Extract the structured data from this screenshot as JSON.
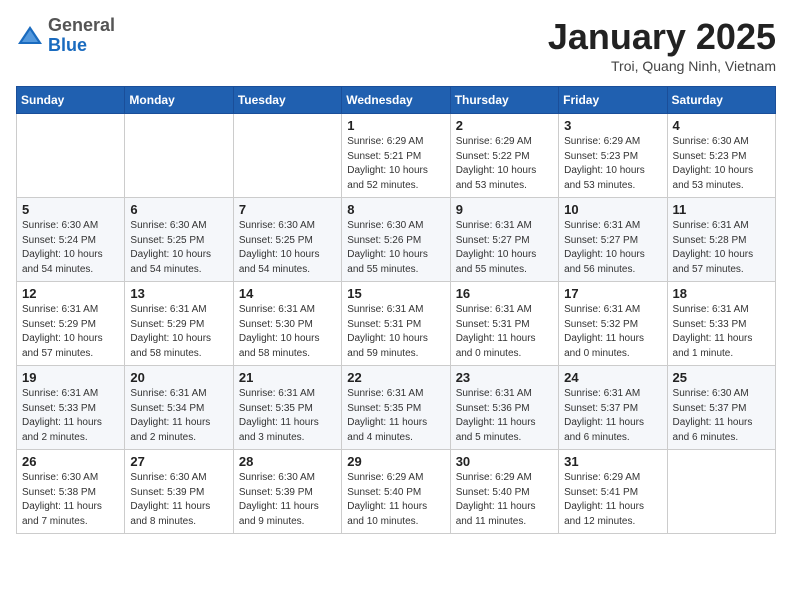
{
  "logo": {
    "general": "General",
    "blue": "Blue"
  },
  "title": "January 2025",
  "subtitle": "Troi, Quang Ninh, Vietnam",
  "headers": [
    "Sunday",
    "Monday",
    "Tuesday",
    "Wednesday",
    "Thursday",
    "Friday",
    "Saturday"
  ],
  "weeks": [
    [
      {
        "day": "",
        "info": ""
      },
      {
        "day": "",
        "info": ""
      },
      {
        "day": "",
        "info": ""
      },
      {
        "day": "1",
        "info": "Sunrise: 6:29 AM\nSunset: 5:21 PM\nDaylight: 10 hours\nand 52 minutes."
      },
      {
        "day": "2",
        "info": "Sunrise: 6:29 AM\nSunset: 5:22 PM\nDaylight: 10 hours\nand 53 minutes."
      },
      {
        "day": "3",
        "info": "Sunrise: 6:29 AM\nSunset: 5:23 PM\nDaylight: 10 hours\nand 53 minutes."
      },
      {
        "day": "4",
        "info": "Sunrise: 6:30 AM\nSunset: 5:23 PM\nDaylight: 10 hours\nand 53 minutes."
      }
    ],
    [
      {
        "day": "5",
        "info": "Sunrise: 6:30 AM\nSunset: 5:24 PM\nDaylight: 10 hours\nand 54 minutes."
      },
      {
        "day": "6",
        "info": "Sunrise: 6:30 AM\nSunset: 5:25 PM\nDaylight: 10 hours\nand 54 minutes."
      },
      {
        "day": "7",
        "info": "Sunrise: 6:30 AM\nSunset: 5:25 PM\nDaylight: 10 hours\nand 54 minutes."
      },
      {
        "day": "8",
        "info": "Sunrise: 6:30 AM\nSunset: 5:26 PM\nDaylight: 10 hours\nand 55 minutes."
      },
      {
        "day": "9",
        "info": "Sunrise: 6:31 AM\nSunset: 5:27 PM\nDaylight: 10 hours\nand 55 minutes."
      },
      {
        "day": "10",
        "info": "Sunrise: 6:31 AM\nSunset: 5:27 PM\nDaylight: 10 hours\nand 56 minutes."
      },
      {
        "day": "11",
        "info": "Sunrise: 6:31 AM\nSunset: 5:28 PM\nDaylight: 10 hours\nand 57 minutes."
      }
    ],
    [
      {
        "day": "12",
        "info": "Sunrise: 6:31 AM\nSunset: 5:29 PM\nDaylight: 10 hours\nand 57 minutes."
      },
      {
        "day": "13",
        "info": "Sunrise: 6:31 AM\nSunset: 5:29 PM\nDaylight: 10 hours\nand 58 minutes."
      },
      {
        "day": "14",
        "info": "Sunrise: 6:31 AM\nSunset: 5:30 PM\nDaylight: 10 hours\nand 58 minutes."
      },
      {
        "day": "15",
        "info": "Sunrise: 6:31 AM\nSunset: 5:31 PM\nDaylight: 10 hours\nand 59 minutes."
      },
      {
        "day": "16",
        "info": "Sunrise: 6:31 AM\nSunset: 5:31 PM\nDaylight: 11 hours\nand 0 minutes."
      },
      {
        "day": "17",
        "info": "Sunrise: 6:31 AM\nSunset: 5:32 PM\nDaylight: 11 hours\nand 0 minutes."
      },
      {
        "day": "18",
        "info": "Sunrise: 6:31 AM\nSunset: 5:33 PM\nDaylight: 11 hours\nand 1 minute."
      }
    ],
    [
      {
        "day": "19",
        "info": "Sunrise: 6:31 AM\nSunset: 5:33 PM\nDaylight: 11 hours\nand 2 minutes."
      },
      {
        "day": "20",
        "info": "Sunrise: 6:31 AM\nSunset: 5:34 PM\nDaylight: 11 hours\nand 2 minutes."
      },
      {
        "day": "21",
        "info": "Sunrise: 6:31 AM\nSunset: 5:35 PM\nDaylight: 11 hours\nand 3 minutes."
      },
      {
        "day": "22",
        "info": "Sunrise: 6:31 AM\nSunset: 5:35 PM\nDaylight: 11 hours\nand 4 minutes."
      },
      {
        "day": "23",
        "info": "Sunrise: 6:31 AM\nSunset: 5:36 PM\nDaylight: 11 hours\nand 5 minutes."
      },
      {
        "day": "24",
        "info": "Sunrise: 6:31 AM\nSunset: 5:37 PM\nDaylight: 11 hours\nand 6 minutes."
      },
      {
        "day": "25",
        "info": "Sunrise: 6:30 AM\nSunset: 5:37 PM\nDaylight: 11 hours\nand 6 minutes."
      }
    ],
    [
      {
        "day": "26",
        "info": "Sunrise: 6:30 AM\nSunset: 5:38 PM\nDaylight: 11 hours\nand 7 minutes."
      },
      {
        "day": "27",
        "info": "Sunrise: 6:30 AM\nSunset: 5:39 PM\nDaylight: 11 hours\nand 8 minutes."
      },
      {
        "day": "28",
        "info": "Sunrise: 6:30 AM\nSunset: 5:39 PM\nDaylight: 11 hours\nand 9 minutes."
      },
      {
        "day": "29",
        "info": "Sunrise: 6:29 AM\nSunset: 5:40 PM\nDaylight: 11 hours\nand 10 minutes."
      },
      {
        "day": "30",
        "info": "Sunrise: 6:29 AM\nSunset: 5:40 PM\nDaylight: 11 hours\nand 11 minutes."
      },
      {
        "day": "31",
        "info": "Sunrise: 6:29 AM\nSunset: 5:41 PM\nDaylight: 11 hours\nand 12 minutes."
      },
      {
        "day": "",
        "info": ""
      }
    ]
  ]
}
